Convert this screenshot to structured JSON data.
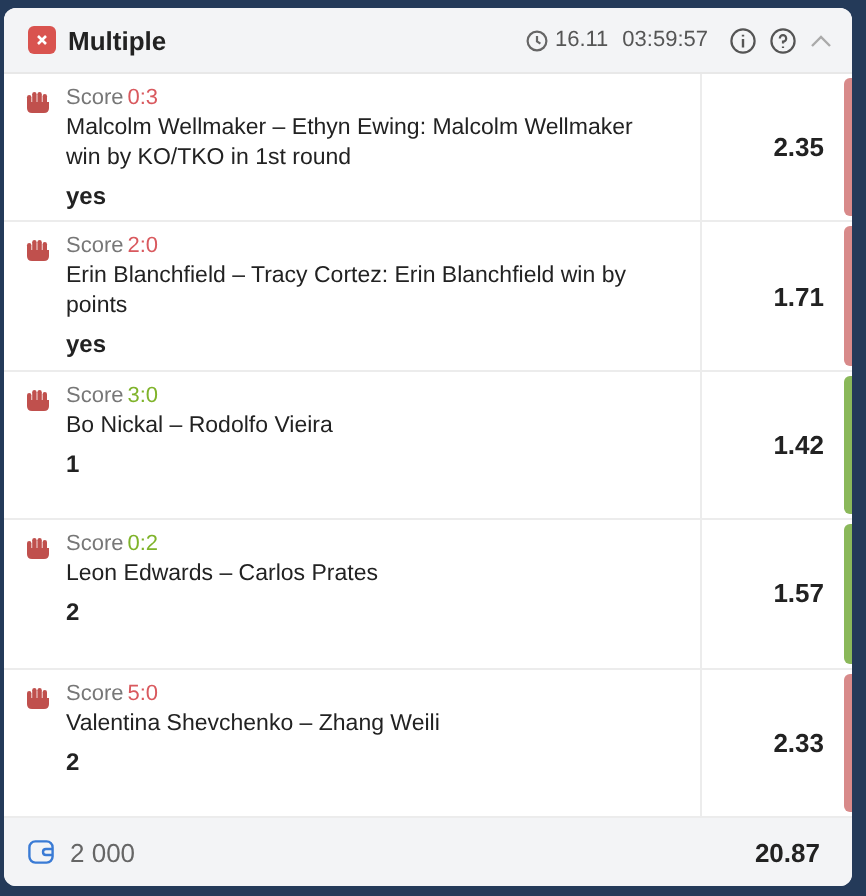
{
  "header": {
    "title": "Multiple",
    "date": "16.11",
    "time": "03:59:57"
  },
  "bets": [
    {
      "score_label": "Score",
      "score": "0:3",
      "won": false,
      "event": "Malcolm Wellmaker – Ethyn Ewing: Malcolm Wellmaker win by KO/TKO in 1st round",
      "pick": "yes",
      "odds": "2.35"
    },
    {
      "score_label": "Score",
      "score": "2:0",
      "won": false,
      "event": "Erin Blanchfield – Tracy Cortez: Erin Blanchfield win by points",
      "pick": "yes",
      "odds": "1.71"
    },
    {
      "score_label": "Score",
      "score": "3:0",
      "won": true,
      "event": "Bo Nickal – Rodolfo Vieira",
      "pick": "1",
      "odds": "1.42"
    },
    {
      "score_label": "Score",
      "score": "0:2",
      "won": true,
      "event": "Leon Edwards – Carlos Prates",
      "pick": "2",
      "odds": "1.57"
    },
    {
      "score_label": "Score",
      "score": "5:0",
      "won": false,
      "event": "Valentina Shevchenko – Zhang Weili",
      "pick": "2",
      "odds": "2.33"
    }
  ],
  "footer": {
    "stake": "2 000",
    "total_odds": "20.87"
  }
}
